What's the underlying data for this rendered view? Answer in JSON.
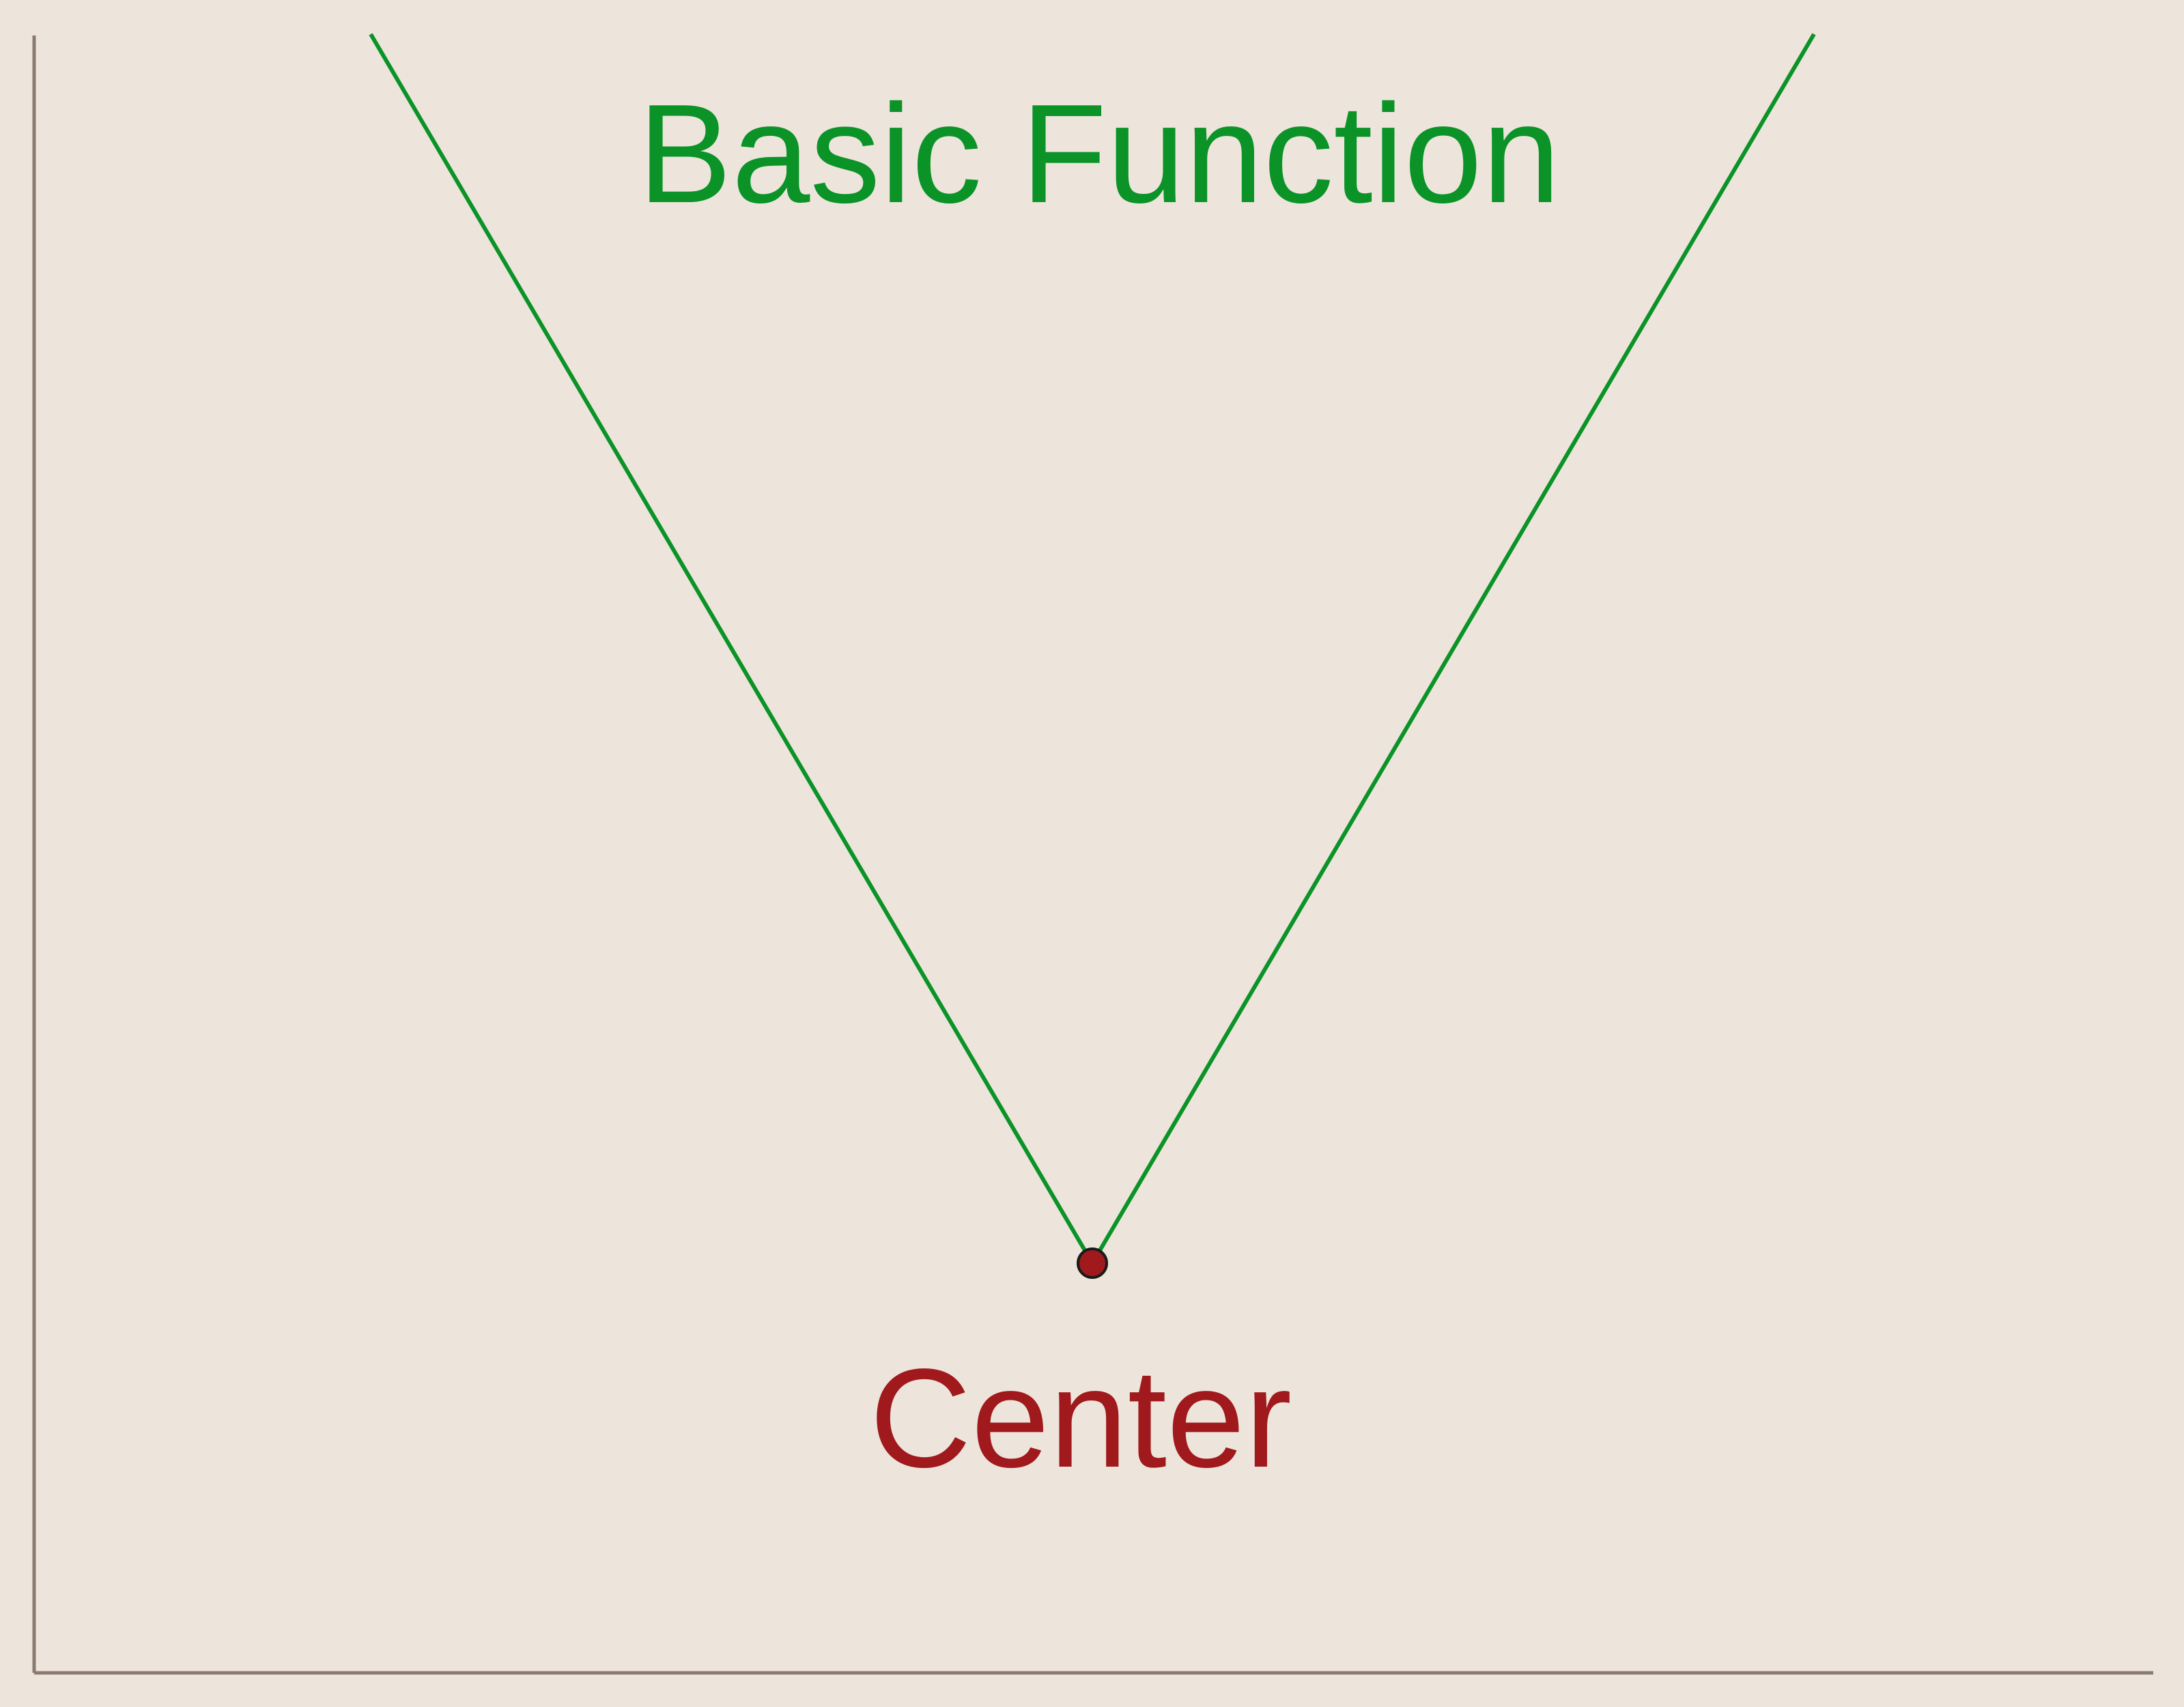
{
  "title": "Basic Function",
  "vertex_label": "Center",
  "colors": {
    "background": "#ede5db",
    "function_line": "#0b9328",
    "axis": "#8a7a70",
    "vertex_fill": "#a0191c",
    "vertex_stroke": "#1a1a1a",
    "title_text": "#0b9328",
    "vertex_text": "#a0191c"
  }
}
